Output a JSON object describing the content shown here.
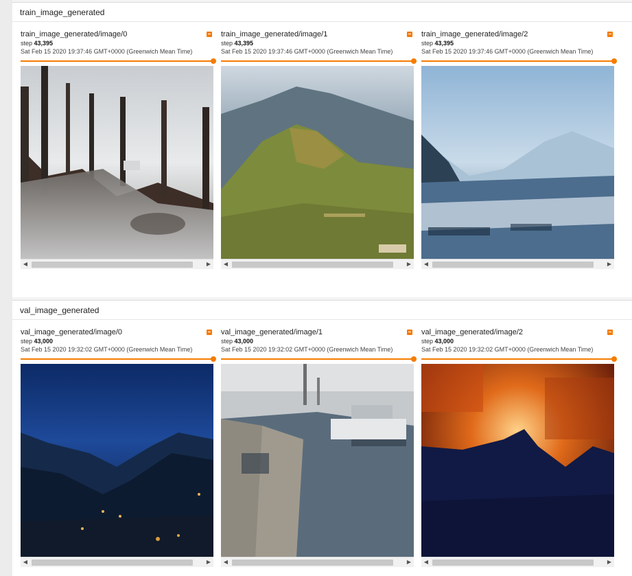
{
  "accent_color": "#f57c00",
  "sections": [
    {
      "header": "train_image_generated",
      "cards": [
        {
          "title": "train_image_generated/image/0",
          "step_label": "step",
          "step_value": "43,395",
          "timestamp": "Sat Feb 15 2020 19:37:46 GMT+0000 (Greenwich Mean Time)",
          "slider_position": 1.0,
          "expand_icon": "expand-icon"
        },
        {
          "title": "train_image_generated/image/1",
          "step_label": "step",
          "step_value": "43,395",
          "timestamp": "Sat Feb 15 2020 19:37:46 GMT+0000 (Greenwich Mean Time)",
          "slider_position": 1.0,
          "expand_icon": "expand-icon"
        },
        {
          "title": "train_image_generated/image/2",
          "step_label": "step",
          "step_value": "43,395",
          "timestamp": "Sat Feb 15 2020 19:37:46 GMT+0000 (Greenwich Mean Time)",
          "slider_position": 1.0,
          "expand_icon": "expand-icon"
        }
      ]
    },
    {
      "header": "val_image_generated",
      "cards": [
        {
          "title": "val_image_generated/image/0",
          "step_label": "step",
          "step_value": "43,000",
          "timestamp": "Sat Feb 15 2020 19:32:02 GMT+0000 (Greenwich Mean Time)",
          "slider_position": 1.0,
          "expand_icon": "expand-icon"
        },
        {
          "title": "val_image_generated/image/1",
          "step_label": "step",
          "step_value": "43,000",
          "timestamp": "Sat Feb 15 2020 19:32:02 GMT+0000 (Greenwich Mean Time)",
          "slider_position": 1.0,
          "expand_icon": "expand-icon"
        },
        {
          "title": "val_image_generated/image/2",
          "step_label": "step",
          "step_value": "43,000",
          "timestamp": "Sat Feb 15 2020 19:32:02 GMT+0000 (Greenwich Mean Time)",
          "slider_position": 1.0,
          "expand_icon": "expand-icon"
        }
      ]
    }
  ],
  "scroll_left_icon": "◀",
  "scroll_right_icon": "▶"
}
